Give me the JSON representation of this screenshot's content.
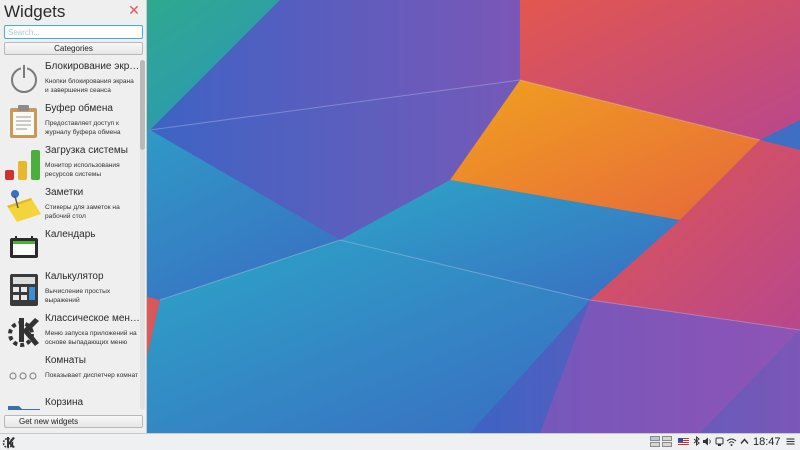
{
  "panel": {
    "title": "Widgets",
    "search_placeholder": "Search...",
    "categories_label": "Categories",
    "get_new_label": "Get new widgets"
  },
  "widgets": [
    {
      "name": "Блокирование экр…",
      "description": "Кнопки блокирования экрана и завершения сеанса",
      "icon": "power-icon"
    },
    {
      "name": "Буфер обмена",
      "description": "Предоставляет доступ к журналу буфера обмена",
      "icon": "clipboard-icon"
    },
    {
      "name": "Загрузка системы",
      "description": "Монитор использования ресурсов системы",
      "icon": "system-load-icon"
    },
    {
      "name": "Заметки",
      "description": "Стикеры для заметок на рабочий стол",
      "icon": "notes-icon"
    },
    {
      "name": "Календарь",
      "description": "",
      "icon": "calendar-icon"
    },
    {
      "name": "Калькулятор",
      "description": "Вычисление простых выражений",
      "icon": "calculator-icon"
    },
    {
      "name": "Классическое мен…",
      "description": "Меню запуска приложений на основе выпадающих меню",
      "icon": "kde-menu-icon"
    },
    {
      "name": "Комнаты",
      "description": "Показывает диспетчер комнат",
      "icon": "activities-icon"
    },
    {
      "name": "Корзина",
      "description": "",
      "icon": "trash-folder-icon"
    }
  ],
  "taskbar": {
    "clock": "18:47"
  },
  "colors": {
    "accent": "#3daee9",
    "close": "#e05561",
    "panel_bg": "#efefef",
    "taskbar_bg": "#eff0f1"
  }
}
